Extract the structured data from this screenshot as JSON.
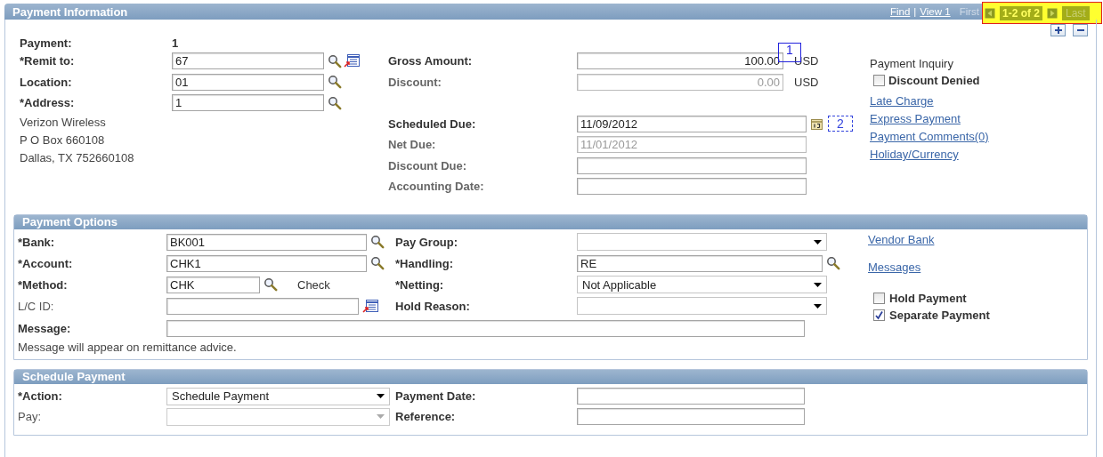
{
  "header": {
    "title": "Payment Information",
    "links": [
      "Find",
      "View 1"
    ],
    "separator": "|",
    "first": "First",
    "counter": "1-2 of 2",
    "last": "Last"
  },
  "info": {
    "left": [
      {
        "kind": "text",
        "label": "Payment:",
        "value": "1"
      },
      {
        "kind": "lookup-detail",
        "label": "*Remit to:",
        "value": "67"
      },
      {
        "kind": "lookup",
        "label": "Location:",
        "value": "01"
      },
      {
        "kind": "lookup",
        "label": "*Address:",
        "value": "1"
      }
    ],
    "address": [
      "Verizon Wireless",
      "P O Box 660108",
      "Dallas, TX  752660108"
    ],
    "amounts": [
      {
        "label": "Gross Amount:",
        "value": "100.00",
        "unit": "USD",
        "disabled": false,
        "annotation": "1"
      },
      {
        "label": "Discount:",
        "value": "0.00",
        "unit": "USD",
        "disabled": true
      }
    ],
    "dates": [
      {
        "kind": "calendar",
        "label": "Scheduled Due:",
        "value": "11/09/2012",
        "disabled": false,
        "annotation": "2"
      },
      {
        "kind": "plain",
        "label": "Net Due:",
        "value": "11/01/2012",
        "disabled": true
      },
      {
        "kind": "plain",
        "label": "Discount Due:",
        "disabled": false
      },
      {
        "kind": "plain",
        "label": "Accounting Date:",
        "disabled": false
      }
    ],
    "inquiry": "Payment Inquiry",
    "discount_denied": {
      "label": "Discount Denied",
      "checked": false
    },
    "links": [
      "Late Charge",
      "Express Payment",
      "Payment Comments(0)",
      "Holiday/Currency"
    ]
  },
  "options": {
    "title": "Payment Options",
    "left": [
      {
        "kind": "lookup",
        "label": "*Bank:",
        "value": "BK001"
      },
      {
        "kind": "lookup",
        "label": "*Account:",
        "value": "CHK1"
      },
      {
        "kind": "lookup-short",
        "label": "*Method:",
        "value": "CHK",
        "description": "Check"
      },
      {
        "kind": "prompt",
        "label": "L/C ID:"
      }
    ],
    "right": [
      {
        "kind": "select",
        "label": "Pay Group:"
      },
      {
        "kind": "lookup",
        "label": "*Handling:",
        "value": "RE"
      },
      {
        "kind": "select",
        "label": "*Netting:",
        "value": "Not Applicable"
      },
      {
        "kind": "select",
        "label": "Hold Reason:"
      }
    ],
    "message": {
      "label": "Message:"
    },
    "note": "Message will appear on remittance advice.",
    "links": [
      "Vendor Bank",
      "Messages"
    ],
    "checks": [
      {
        "label": "Hold Payment",
        "checked": false
      },
      {
        "label": "Separate Payment",
        "checked": true
      }
    ]
  },
  "schedule": {
    "title": "Schedule Payment",
    "left": [
      {
        "label": "*Action:",
        "value": "Schedule Payment",
        "disabled": false
      },
      {
        "label": "Pay:",
        "disabled": true
      }
    ],
    "right": [
      {
        "label": "Payment Date:"
      },
      {
        "label": "Reference:"
      }
    ]
  }
}
